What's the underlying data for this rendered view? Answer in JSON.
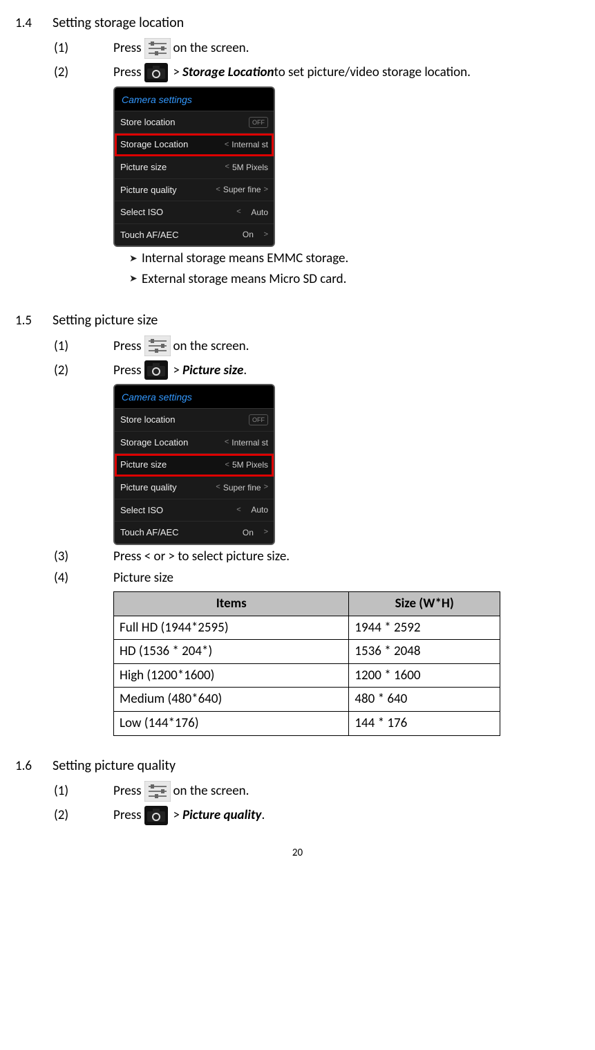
{
  "sections": [
    {
      "number": "1.4",
      "title": "Setting storage location",
      "steps": {
        "s1_num": "(1)",
        "s1_press": "Press",
        "s1_after": " on the screen.",
        "s2_num": "(2)",
        "s2_press": "Press",
        "s2_bold": "Storage Location",
        "s2_tail": " to set picture/video storage location."
      },
      "bullets": [
        "Internal storage means EMMC storage.",
        "External storage means Micro SD card."
      ]
    },
    {
      "number": "1.5",
      "title": "Setting picture size",
      "steps": {
        "s1_num": "(1)",
        "s1_press": "Press",
        "s1_after": " on the screen.",
        "s2_num": "(2)",
        "s2_press": "Press",
        "s2_bold": "Picture size",
        "s2_tail": ".",
        "s3_num": "(3)",
        "s3_text": "Press < or > to select picture size.",
        "s4_num": "(4)",
        "s4_text": "Picture size"
      },
      "table": {
        "h1": "Items",
        "h2": "Size (W*H)",
        "rows": [
          {
            "a": "Full HD (1944*2595)",
            "b": "1944 * 2592"
          },
          {
            "a": "HD (1536 * 204*)",
            "b": "1536 * 2048"
          },
          {
            "a": "High (1200*1600)",
            "b": "1200 * 1600"
          },
          {
            "a": "Medium (480*640)",
            "b": "480 * 640"
          },
          {
            "a": "Low (144*176)",
            "b": "144 * 176"
          }
        ]
      }
    },
    {
      "number": "1.6",
      "title": "Setting picture quality",
      "steps": {
        "s1_num": "(1)",
        "s1_press": "Press",
        "s1_after": " on the screen.",
        "s2_num": "(2)",
        "s2_press": "Press",
        "s2_bold": "Picture quality",
        "s2_tail": "."
      }
    }
  ],
  "panel": {
    "header": "Camera settings",
    "rows": [
      {
        "label": "Store location",
        "value": "OFF",
        "off": true
      },
      {
        "label": "Storage Location",
        "value": "Internal st",
        "left": true
      },
      {
        "label": "Picture size",
        "value": "5M Pixels",
        "left": true
      },
      {
        "label": "Picture quality",
        "value": "Super fine",
        "both": true
      },
      {
        "label": "Select ISO",
        "value": "Auto",
        "left": true
      },
      {
        "label": "Touch AF/AEC",
        "value": "On",
        "right": true
      }
    ]
  },
  "gt": ">",
  "page_num": "20"
}
